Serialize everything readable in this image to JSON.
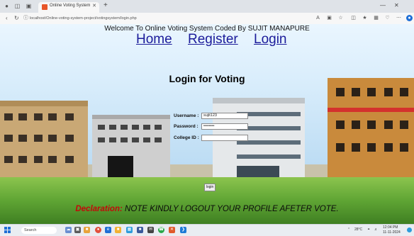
{
  "browser": {
    "tab_title": "Online Voting System",
    "url": "localhost/Online-voting-system-project/votingsystem/login.php"
  },
  "page": {
    "welcome": "Welcome To Online Voting System Coded By SUJIT MANAPURE",
    "nav": {
      "home": "Home",
      "register": "Register",
      "login": "Login"
    },
    "title": "Login for Voting",
    "form": {
      "username_label": "Username :",
      "username_value": "sujit123",
      "password_label": "Password :",
      "password_value": "••••••••",
      "college_label": "College ID :",
      "college_value": "",
      "submit_label": "login"
    },
    "declaration_label": "Declaration:",
    "declaration_text": "NOTE KINDLY LOGOUT YOUR PROFILE AFETER VOTE."
  },
  "taskbar": {
    "search_placeholder": "Search",
    "tray_temp": "28°C",
    "clock_time": "12:04 PM",
    "clock_date": "11-11-2024"
  },
  "colors": {
    "link": "#1b1b9a",
    "declaration_label": "#c20a0a",
    "tab_favicon": "#e8562a"
  }
}
